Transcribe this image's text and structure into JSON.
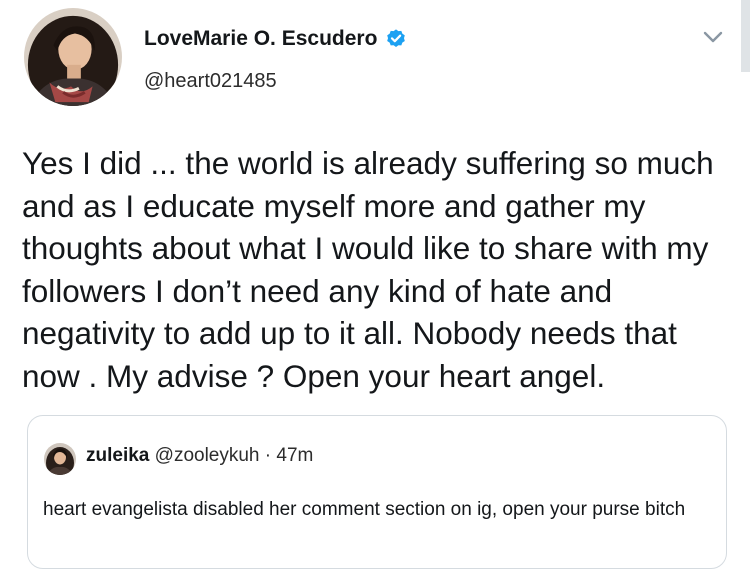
{
  "author": {
    "display_name": "LoveMarie O. Escudero",
    "handle": "@heart021485",
    "verified": true,
    "avatar_icon": "profile-photo",
    "verified_icon": "verified-badge-icon"
  },
  "tweet": {
    "text": "Yes I did ... the world is already suffering so much and as I educate myself more and gather my thoughts about what I would like to share with my followers I don’t need any kind of hate and negativity to add up to it all. Nobody needs that now . My advise ? Open your heart angel."
  },
  "quoted_tweet": {
    "display_name": "zuleika",
    "handle": "@zooleykuh",
    "separator": "·",
    "time": "47m",
    "text": "heart evangelista disabled her comment section on ig, open your purse bitch"
  },
  "colors": {
    "text": "#14171a",
    "secondary_text": "#2c2c2c",
    "verified": "#1da1f2",
    "border": "#d5dbe0"
  }
}
